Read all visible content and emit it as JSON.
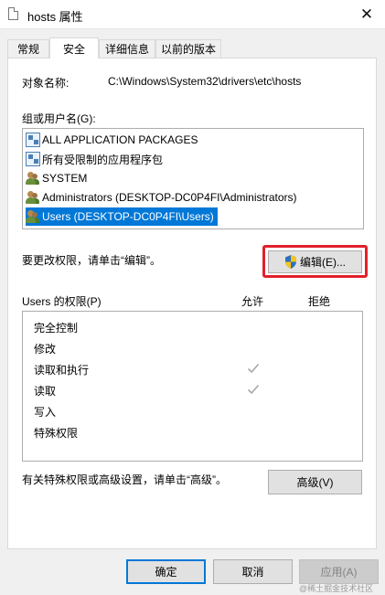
{
  "window": {
    "title": "hosts 属性",
    "close_glyph": "✕"
  },
  "tabs": [
    {
      "label": "常规"
    },
    {
      "label": "安全"
    },
    {
      "label": "详细信息"
    },
    {
      "label": "以前的版本"
    }
  ],
  "security": {
    "object_name_label": "对象名称:",
    "object_name_value": "C:\\Windows\\System32\\drivers\\etc\\hosts",
    "groups_label": "组或用户名(G):",
    "groups": [
      {
        "name": "ALL APPLICATION PACKAGES",
        "icon": "package-icon"
      },
      {
        "name": "所有受限制的应用程序包",
        "icon": "package-icon"
      },
      {
        "name": "SYSTEM",
        "icon": "users-icon"
      },
      {
        "name": "Administrators (DESKTOP-DC0P4FI\\Administrators)",
        "icon": "users-icon"
      },
      {
        "name": "Users (DESKTOP-DC0P4FI\\Users)",
        "icon": "users-icon",
        "selected": true
      }
    ],
    "change_hint": "要更改权限，请单击“编辑”。",
    "edit_button": "编辑(E)...",
    "permissions_label": "Users 的权限(P)",
    "allow_header": "允许",
    "deny_header": "拒绝",
    "permissions": [
      {
        "name": "完全控制",
        "allow": false
      },
      {
        "name": "修改",
        "allow": false
      },
      {
        "name": "读取和执行",
        "allow": true
      },
      {
        "name": "读取",
        "allow": true
      },
      {
        "name": "写入",
        "allow": false
      },
      {
        "name": "特殊权限",
        "allow": false
      }
    ],
    "advanced_hint": "有关特殊权限或高级设置，请单击“高级”。",
    "advanced_button": "高级(V)"
  },
  "footer": {
    "ok": "确定",
    "cancel": "取消",
    "apply": "应用(A)"
  },
  "watermark": "@稀土掘金技术社区",
  "colors": {
    "selection": "#0078d7",
    "highlight_border": "#e2202b",
    "check_gray": "#a8a8a8"
  }
}
